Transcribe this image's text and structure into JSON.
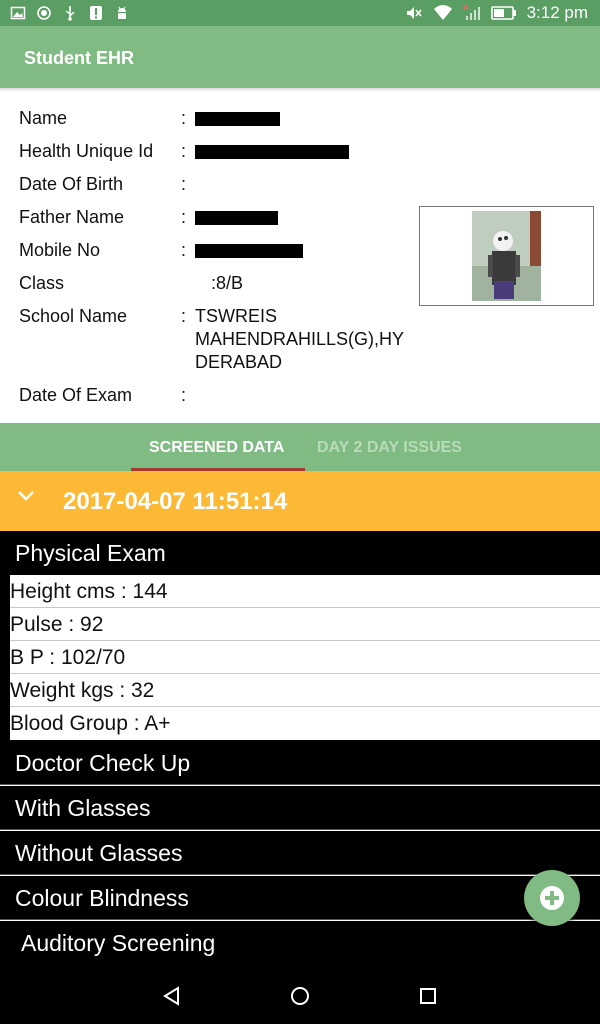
{
  "status_bar": {
    "time": "3:12 pm",
    "left_icons": [
      "image-icon",
      "target-icon",
      "usb-icon",
      "notification-icon",
      "android-icon"
    ],
    "right_icons": [
      "mute-icon",
      "wifi-icon",
      "no-signal-icon",
      "battery-icon"
    ]
  },
  "app_bar": {
    "title": "Student EHR"
  },
  "profile": {
    "colon": ":",
    "name_label": "Name",
    "health_id_label": "Health Unique Id",
    "dob_label": "Date Of Birth",
    "father_label": "Father Name",
    "mobile_label": "Mobile No",
    "class_label": "Class",
    "class_value": ":8/B",
    "school_label": "School Name",
    "school_line1": "TSWREIS",
    "school_line2": "MAHENDRAHILLS(G),HY",
    "school_line3": "DERABAD",
    "exam_date_label": "Date Of Exam"
  },
  "tabs": {
    "screened": "SCREENED DATA",
    "day2day": "DAY 2 DAY ISSUES"
  },
  "record": {
    "datetime": "2017-04-07 11:51:14"
  },
  "sections": {
    "physical_exam": "Physical Exam",
    "doctor_checkup": "Doctor Check Up",
    "with_glasses": "With Glasses",
    "without_glasses": "Without Glasses",
    "colour_blindness": "Colour Blindness",
    "auditory": "Auditory Screening"
  },
  "physical_exam_rows": {
    "height": "Height cms  :  144",
    "pulse": "Pulse  :  92",
    "bp": "B P  :  102/70",
    "weight": "Weight kgs  :  32",
    "blood": "Blood Group  :  A+"
  },
  "colors": {
    "status_bar": "#5a9e63",
    "app_bar": "#7fbb82",
    "date_bar": "#fbb935",
    "tab_indicator": "#a33a2e"
  }
}
